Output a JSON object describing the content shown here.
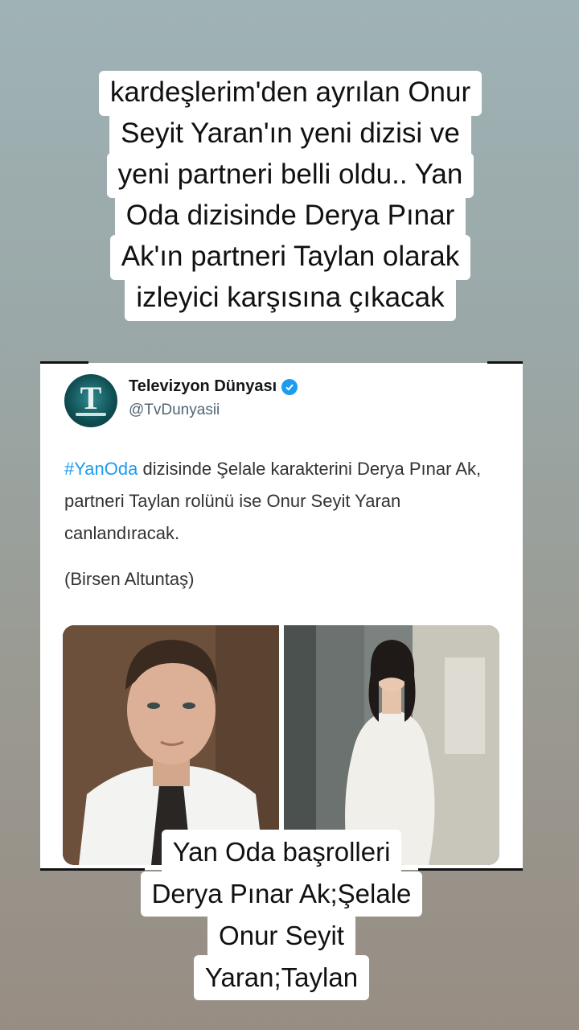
{
  "top_caption": {
    "lines": [
      "kardeşlerim'den ayrılan Onur",
      "Seyit Yaran'ın yeni dizisi ve",
      "yeni partneri belli oldu.. Yan",
      "Oda dizisinde Derya Pınar",
      "Ak'ın partneri Taylan olarak",
      "izleyici karşısına çıkacak"
    ]
  },
  "tweet": {
    "account_name": "Televizyon Dünyası",
    "handle": "@TvDunyasii",
    "avatar_icon": "televizyon-dunyasi-logo",
    "verified_icon": "verified-badge-icon",
    "hashtag": "#YanOda",
    "text_after_hashtag": " dizisinde Şelale karakterini Derya Pınar Ak, partneri Taylan rolünü ise Onur Seyit Yaran canlandıracak.",
    "credit": "(Birsen Altuntaş)",
    "hashtag_color": "#1d9bf0"
  },
  "bottom_caption": {
    "lines": [
      "Yan Oda başrolleri",
      "Derya Pınar Ak;Şelale",
      "Onur Seyit",
      "Yaran;Taylan"
    ]
  }
}
